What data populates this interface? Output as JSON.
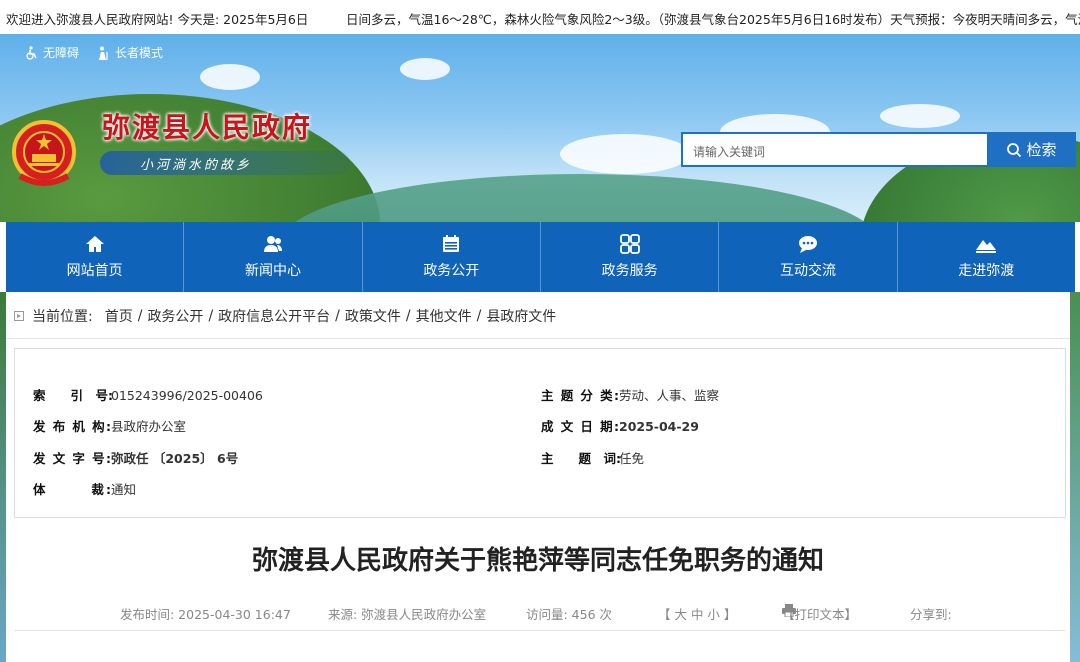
{
  "topbar": {
    "welcome": "欢迎进入弥渡县人民政府网站! 今天是:   2025年5月6日",
    "ticker": "日间多云，气温16～28℃，森林火险气象风险2～3级。（弥渡县气象台2025年5月6日16时发布）天气预报：今夜明天晴间多云，气温"
  },
  "header": {
    "accessibility": "无障碍",
    "elder_mode": "长者模式",
    "site_title": "弥渡县人民政府",
    "slogan": "小河淌水的故乡",
    "search_placeholder": "请输入关键词",
    "search_button": "检索"
  },
  "nav": [
    {
      "label": "网站首页",
      "icon": "home-icon"
    },
    {
      "label": "新闻中心",
      "icon": "people-icon"
    },
    {
      "label": "政务公开",
      "icon": "calendar-icon"
    },
    {
      "label": "政务服务",
      "icon": "grid-icon"
    },
    {
      "label": "互动交流",
      "icon": "chat-icon"
    },
    {
      "label": "走进弥渡",
      "icon": "mountain-icon"
    }
  ],
  "breadcrumb": {
    "label": "当前位置:",
    "items": [
      "首页",
      "政务公开",
      "政府信息公开平台",
      "政策文件",
      "其他文件",
      "县政府文件"
    ]
  },
  "meta": {
    "index_key": "索　　引　号:",
    "index_val": "015243996/2025-00406",
    "category_key": "主 题 分 类:",
    "category_val": "劳动、人事、监察",
    "issuer_key": "发 布 机 构:",
    "issuer_val": "县政府办公室",
    "date_key": "成 文 日 期:",
    "date_val": "2025-04-29",
    "docno_key": "发 文 字 号:",
    "docno_val": "弥政任 〔2025〕 6号",
    "subject_key": "主　　题　词:",
    "subject_val": "任免",
    "genre_key": "体　　　裁:",
    "genre_val": "通知"
  },
  "article": {
    "title": "弥渡县人民政府关于熊艳萍等同志任免职务的通知",
    "publish_time": "发布时间:  2025-04-30 16:47",
    "source": "来源:  弥渡县人民政府办公室",
    "visits": "访问量:  456 次",
    "font_size": "【 大  中  小 】",
    "print": "【打印文本】",
    "share": "分享到:"
  }
}
